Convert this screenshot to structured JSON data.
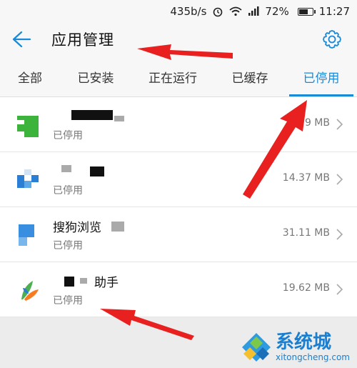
{
  "status_bar": {
    "speed": "435b/s",
    "battery_percent": "72%",
    "battery_level": 0.72,
    "time": "11:27"
  },
  "header": {
    "title": "应用管理"
  },
  "tabs": [
    {
      "label": "全部",
      "active": false
    },
    {
      "label": "已安装",
      "active": false
    },
    {
      "label": "正在运行",
      "active": false
    },
    {
      "label": "已缓存",
      "active": false
    },
    {
      "label": "已停用",
      "active": true
    }
  ],
  "apps": [
    {
      "name": "",
      "status": "已停用",
      "size": "9 MB"
    },
    {
      "name": "",
      "status": "已停用",
      "size": "14.37 MB"
    },
    {
      "name": "搜狗浏览",
      "status": "已停用",
      "size": "31.11 MB"
    },
    {
      "name": "助手",
      "status": "已停用",
      "size": "19.62 MB"
    }
  ],
  "watermark": {
    "title": "系统城",
    "subtitle": "xitongcheng.com"
  },
  "colors": {
    "accent": "#1a8ad6",
    "annotation": "#e8201f"
  }
}
